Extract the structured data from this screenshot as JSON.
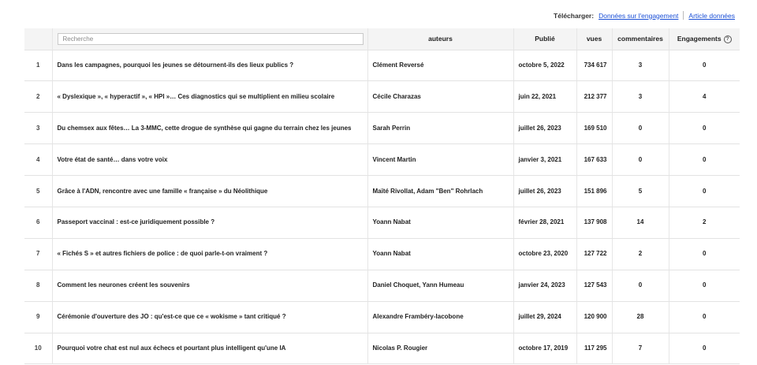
{
  "download": {
    "label": "Télécharger:",
    "link_engagement": "Données sur l'engagement",
    "link_article": "Article données"
  },
  "table": {
    "search_placeholder": "Recherche",
    "headers": {
      "auteurs": "auteurs",
      "publie": "Publié",
      "vues": "vues",
      "commentaires": "commentaires",
      "engagements": "Engagements"
    },
    "help_icon_glyph": "?",
    "rows": [
      {
        "idx": "1",
        "title": "Dans les campagnes, pourquoi les jeunes se détournent-ils des lieux publics ?",
        "authors": "Clément Reversé",
        "date": "octobre 5, 2022",
        "views": "734 617",
        "comments": "3",
        "engagements": "0"
      },
      {
        "idx": "2",
        "title": "« Dyslexique », « hyperactif », « HPI »… Ces diagnostics qui se multiplient en milieu scolaire",
        "authors": "Cécile Charazas",
        "date": "juin 22, 2021",
        "views": "212 377",
        "comments": "3",
        "engagements": "4"
      },
      {
        "idx": "3",
        "title": "Du chemsex aux fêtes… La 3-MMC, cette drogue de synthèse qui gagne du terrain chez les jeunes",
        "authors": "Sarah Perrin",
        "date": "juillet 26, 2023",
        "views": "169 510",
        "comments": "0",
        "engagements": "0"
      },
      {
        "idx": "4",
        "title": "Votre état de santé… dans votre voix",
        "authors": "Vincent Martin",
        "date": "janvier 3, 2021",
        "views": "167 633",
        "comments": "0",
        "engagements": "0"
      },
      {
        "idx": "5",
        "title": "Grâce à l'ADN, rencontre avec une famille « française » du Néolithique",
        "authors": "Maïté Rivollat, Adam \"Ben\" Rohrlach",
        "date": "juillet 26, 2023",
        "views": "151 896",
        "comments": "5",
        "engagements": "0"
      },
      {
        "idx": "6",
        "title": "Passeport vaccinal : est-ce juridiquement possible ?",
        "authors": "Yoann Nabat",
        "date": "février 28, 2021",
        "views": "137 908",
        "comments": "14",
        "engagements": "2"
      },
      {
        "idx": "7",
        "title": "« Fichés S » et autres fichiers de police : de quoi parle-t-on vraiment ?",
        "authors": "Yoann Nabat",
        "date": "octobre 23, 2020",
        "views": "127 722",
        "comments": "2",
        "engagements": "0"
      },
      {
        "idx": "8",
        "title": "Comment les neurones créent les souvenirs",
        "authors": "Daniel Choquet, Yann Humeau",
        "date": "janvier 24, 2023",
        "views": "127 543",
        "comments": "0",
        "engagements": "0"
      },
      {
        "idx": "9",
        "title": "Cérémonie d'ouverture des JO : qu'est-ce que ce « wokisme » tant critiqué ?",
        "authors": "Alexandre Frambéry-Iacobone",
        "date": "juillet 29, 2024",
        "views": "120 900",
        "comments": "28",
        "engagements": "0"
      },
      {
        "idx": "10",
        "title": "Pourquoi votre chat est nul aux échecs et pourtant plus intelligent qu'une IA",
        "authors": "Nicolas P. Rougier",
        "date": "octobre 17, 2019",
        "views": "117 295",
        "comments": "7",
        "engagements": "0"
      }
    ]
  }
}
